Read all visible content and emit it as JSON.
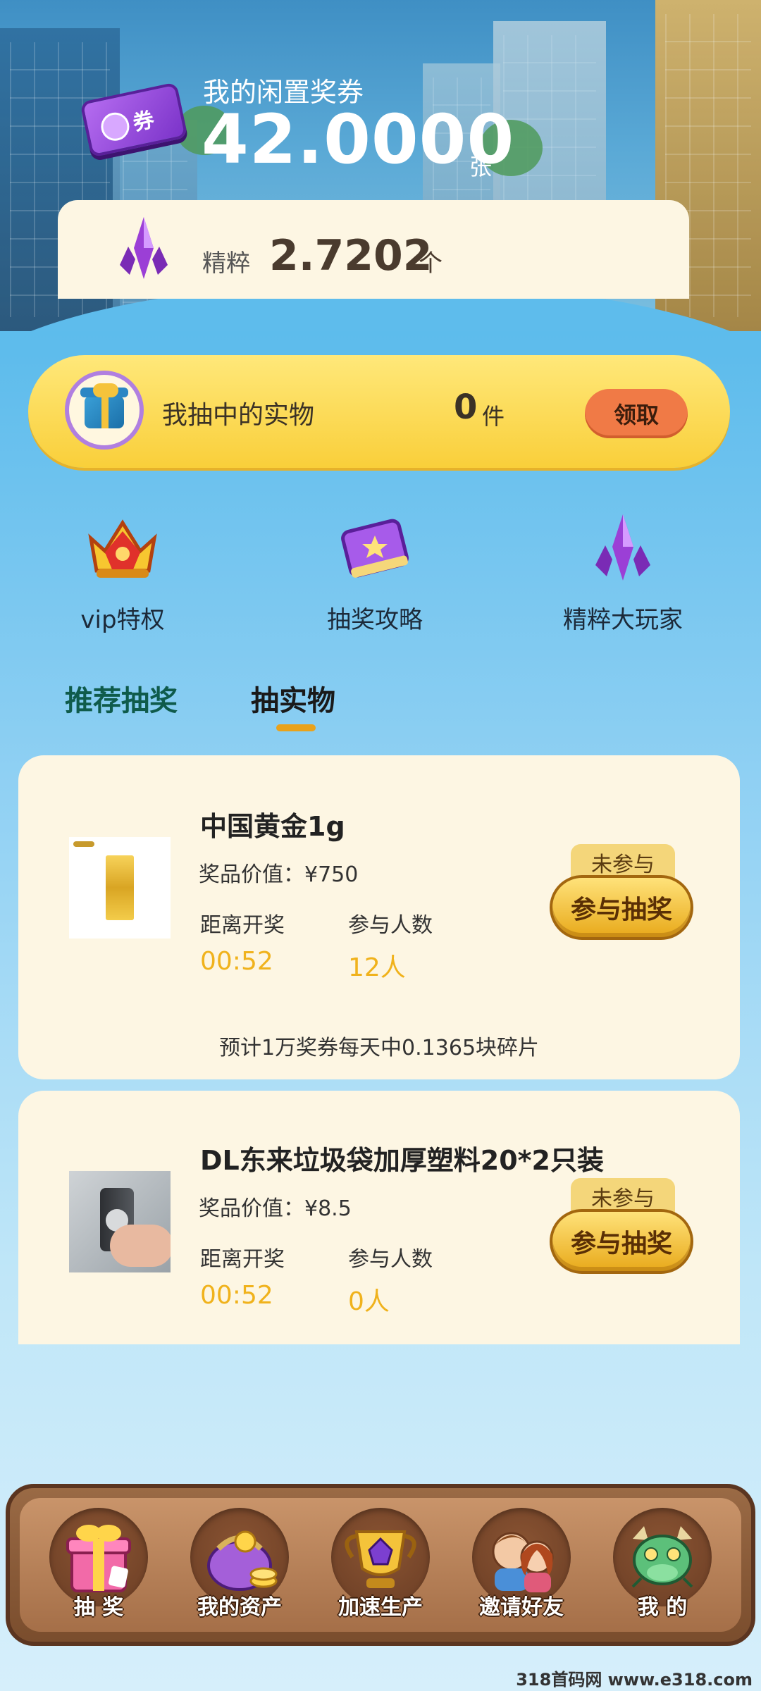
{
  "header": {
    "vouchers_title": "我的闲置奖券",
    "vouchers_value": "42.0000",
    "vouchers_unit": "张",
    "ticket_label": "券",
    "essence_label": "精粹",
    "essence_value": "2.7202",
    "essence_unit": "个"
  },
  "prize_bar": {
    "label": "我抽中的实物",
    "count": "0",
    "unit": "件",
    "claim_label": "领取"
  },
  "quick_links": [
    {
      "label": "vip特权",
      "icon": "crown-icon"
    },
    {
      "label": "抽奖攻略",
      "icon": "guide-book-icon"
    },
    {
      "label": "精粹大玩家",
      "icon": "crystal-icon"
    }
  ],
  "tabs": [
    {
      "label": "推荐抽奖",
      "active": false
    },
    {
      "label": "抽实物",
      "active": true
    }
  ],
  "lotteries": [
    {
      "title": "中国黄金1g",
      "value_label": "奖品价值：",
      "value": "¥750",
      "countdown_label": "距离开奖",
      "countdown": "00:52",
      "participants_label": "参与人数",
      "participants": "12人",
      "status": "未参与",
      "join_label": "参与抽奖",
      "note": "预计1万奖券每天中0.1365块碎片"
    },
    {
      "title": "DL东来垃圾袋加厚塑料20*2只装",
      "value_label": "奖品价值：",
      "value": "¥8.5",
      "countdown_label": "距离开奖",
      "countdown": "00:52",
      "participants_label": "参与人数",
      "participants": "0人",
      "status": "未参与",
      "join_label": "参与抽奖"
    }
  ],
  "bottom_nav": [
    {
      "label": "抽 奖",
      "icon": "gift-box-icon"
    },
    {
      "label": "我的资产",
      "icon": "purse-icon"
    },
    {
      "label": "加速生产",
      "icon": "trophy-icon"
    },
    {
      "label": "邀请好友",
      "icon": "friends-icon"
    },
    {
      "label": "我 的",
      "icon": "dragon-icon"
    }
  ],
  "watermark": "318首码网 www.e318.com",
  "colors": {
    "accent_yellow": "#f9cf3a",
    "claim_orange": "#f07a46",
    "countdown_gold": "#f0b21c",
    "card_bg": "#fdf6e3",
    "tab_green": "#0f5b4b"
  }
}
